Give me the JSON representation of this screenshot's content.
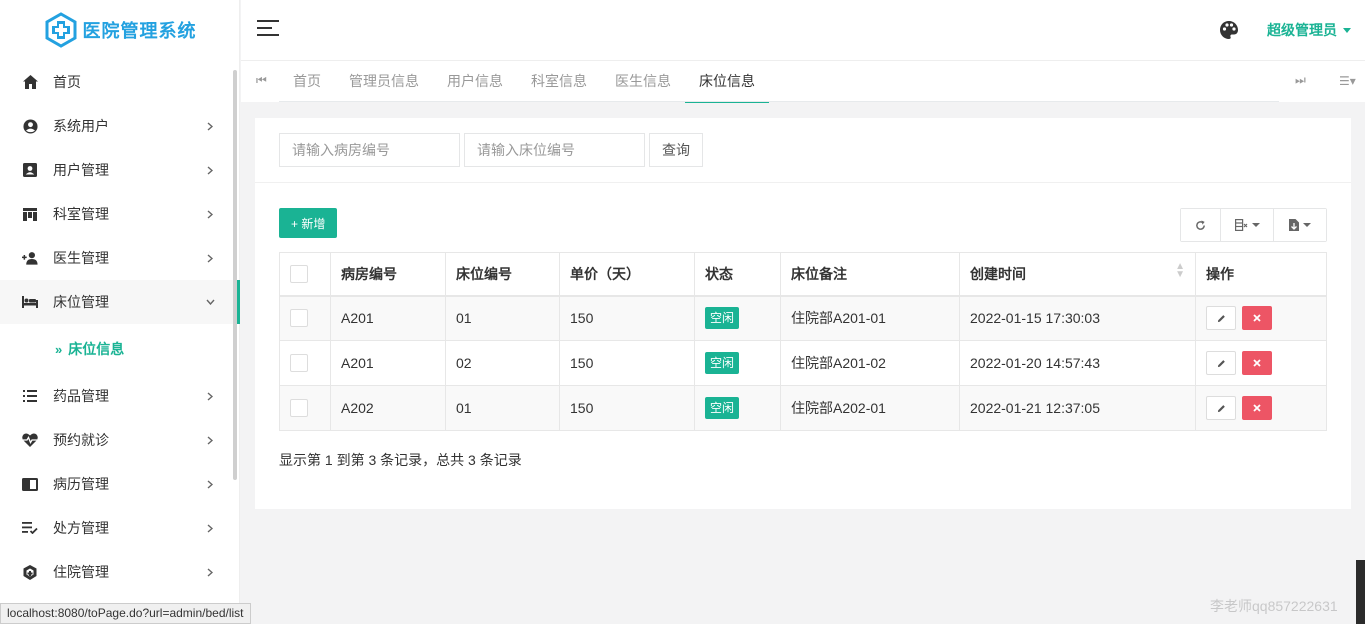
{
  "logo": {
    "text": "医院管理系统"
  },
  "sidebar": {
    "items": [
      {
        "label": "首页",
        "icon": "home-icon",
        "arrow": false
      },
      {
        "label": "系统用户",
        "icon": "user-circle-icon",
        "arrow": true
      },
      {
        "label": "用户管理",
        "icon": "id-card-icon",
        "arrow": true
      },
      {
        "label": "科室管理",
        "icon": "building-icon",
        "arrow": true
      },
      {
        "label": "医生管理",
        "icon": "user-plus-icon",
        "arrow": true
      },
      {
        "label": "床位管理",
        "icon": "bed-icon",
        "arrow": true,
        "open": true
      },
      {
        "label": "药品管理",
        "icon": "list-icon",
        "arrow": true
      },
      {
        "label": "预约就诊",
        "icon": "heartbeat-icon",
        "arrow": true
      },
      {
        "label": "病历管理",
        "icon": "book-icon",
        "arrow": true
      },
      {
        "label": "处方管理",
        "icon": "checklist-icon",
        "arrow": true
      },
      {
        "label": "住院管理",
        "icon": "shield-icon",
        "arrow": true
      }
    ],
    "submenu": {
      "chevron": "»",
      "label": "床位信息"
    }
  },
  "header": {
    "user": "超级管理员"
  },
  "tabs": [
    {
      "label": "首页"
    },
    {
      "label": "管理员信息"
    },
    {
      "label": "用户信息"
    },
    {
      "label": "科室信息"
    },
    {
      "label": "医生信息"
    },
    {
      "label": "床位信息",
      "active": true
    }
  ],
  "search": {
    "room_placeholder": "请输入病房编号",
    "bed_placeholder": "请输入床位编号",
    "query_label": "查询"
  },
  "toolbar": {
    "add_label": "+ 新增"
  },
  "table": {
    "columns": [
      "病房编号",
      "床位编号",
      "单价（天）",
      "状态",
      "床位备注",
      "创建时间",
      "操作"
    ],
    "rows": [
      {
        "room": "A201",
        "bed": "01",
        "price": "150",
        "status": "空闲",
        "note": "住院部A201-01",
        "created": "2022-01-15 17:30:03"
      },
      {
        "room": "A201",
        "bed": "02",
        "price": "150",
        "status": "空闲",
        "note": "住院部A201-02",
        "created": "2022-01-20 14:57:43"
      },
      {
        "room": "A202",
        "bed": "01",
        "price": "150",
        "status": "空闲",
        "note": "住院部A202-01",
        "created": "2022-01-21 12:37:05"
      }
    ]
  },
  "summary": "显示第 1 到第 3 条记录，总共 3 条记录",
  "statusbar": "localhost:8080/toPage.do?url=admin/bed/list",
  "watermark": "李老师qq857222631",
  "colors": {
    "accent": "#1ab394",
    "danger": "#ed5565",
    "logo": "#23a1e0"
  }
}
